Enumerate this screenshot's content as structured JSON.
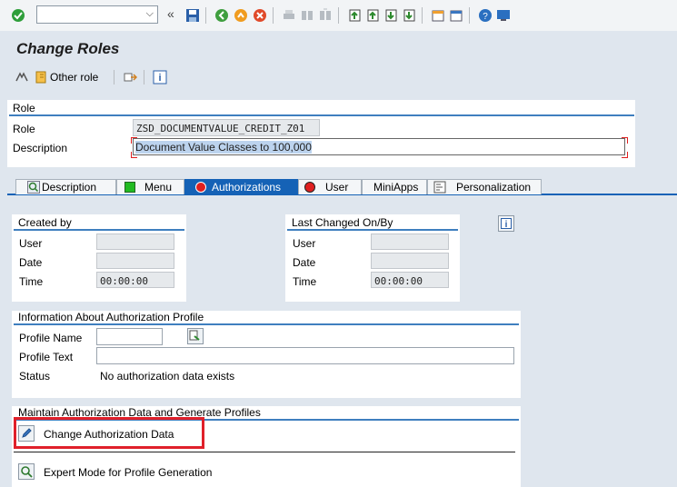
{
  "toolbar": {
    "command_placeholder": "",
    "icons": [
      "check-icon",
      "back-icon",
      "save-icon",
      "green-back-icon",
      "exit-icon",
      "cancel-icon",
      "print-icon",
      "find-icon",
      "find-next-icon",
      "first-page-icon",
      "prev-page-icon",
      "next-page-icon",
      "last-page-icon",
      "new-session-icon",
      "shortcut-icon",
      "help-icon",
      "customize-icon"
    ]
  },
  "page": {
    "title": "Change Roles"
  },
  "app_toolbar": {
    "other_role_label": "Other role"
  },
  "role_group": {
    "title": "Role",
    "role_label": "Role",
    "role_value": "ZSD_DOCUMENTVALUE_CREDIT_Z01",
    "description_label": "Description",
    "description_value": "Document Value Classes to 100,000"
  },
  "tabs": [
    {
      "label": "Description"
    },
    {
      "label": "Menu"
    },
    {
      "label": "Authorizations"
    },
    {
      "label": "User"
    },
    {
      "label": "MiniApps"
    },
    {
      "label": "Personalization"
    }
  ],
  "active_tab": "Authorizations",
  "created_by": {
    "title": "Created by",
    "user_label": "User",
    "user_value": "",
    "date_label": "Date",
    "date_value": "",
    "time_label": "Time",
    "time_value": "00:00:00"
  },
  "last_changed": {
    "title": "Last Changed On/By",
    "user_label": "User",
    "user_value": "",
    "date_label": "Date",
    "date_value": "",
    "time_label": "Time",
    "time_value": "00:00:00"
  },
  "auth_profile": {
    "title": "Information About Authorization Profile",
    "profile_name_label": "Profile Name",
    "profile_name_value": "",
    "profile_text_label": "Profile Text",
    "profile_text_value": "",
    "status_label": "Status",
    "status_value": "No authorization data exists"
  },
  "maintain": {
    "title": "Maintain Authorization Data and Generate Profiles",
    "change_auth_label": "Change Authorization Data",
    "expert_mode_label": "Expert Mode for Profile Generation"
  },
  "colors": {
    "accent": "#1562b6",
    "highlight": "#e02020",
    "background": "#dfe6ee"
  }
}
